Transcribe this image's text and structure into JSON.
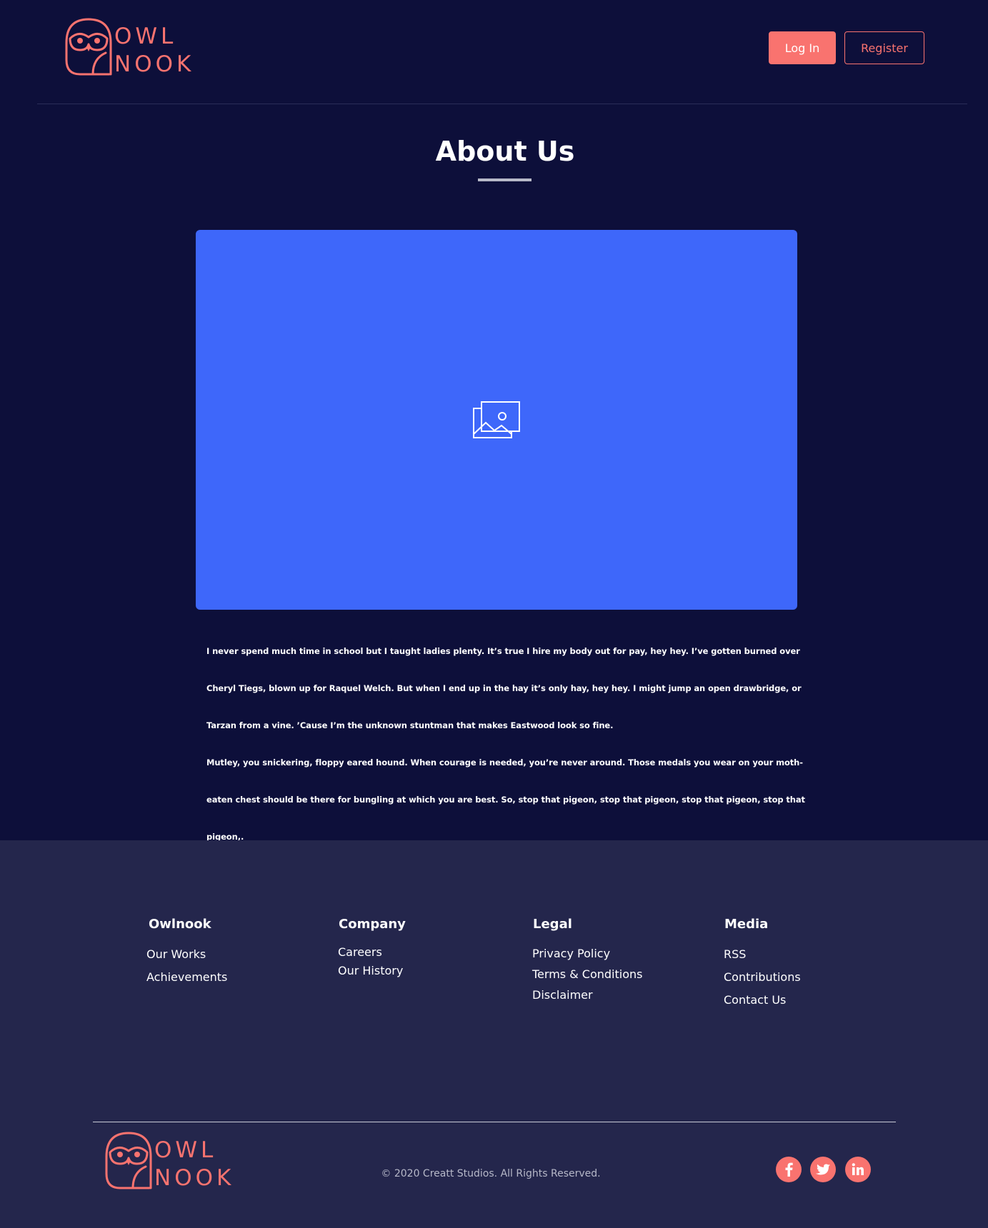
{
  "brand": {
    "logo_line1": "OWL",
    "logo_line2": "NOOK",
    "accent_color": "#f9736f"
  },
  "header": {
    "login_label": "Log In",
    "register_label": "Register"
  },
  "main": {
    "title": "About Us",
    "image_icon": "image-placeholder-icon",
    "image_bg_color": "#3e67fa",
    "paragraphs": [
      "I never spend much time in school but I taught ladies plenty. It’s true I hire my body out for pay, hey hey. I’ve gotten burned over Cheryl Tiegs, blown up for Raquel Welch. But when I end up in the hay it’s only hay, hey hey. I might jump an open drawbridge, or Tarzan from a vine. ’Cause I’m the unknown stuntman that makes Eastwood look so fine.",
      "Mutley, you snickering, floppy eared hound. When courage is needed, you’re never around. Those medals you wear on your moth-eaten chest should be there for bungling at which you are best. So, stop that pigeon, stop that pigeon, stop that pigeon, stop that pigeon,."
    ]
  },
  "footer": {
    "columns": [
      {
        "heading": "Owlnook",
        "links": [
          "Our Works",
          "Achievements"
        ]
      },
      {
        "heading": "Company",
        "links": [
          "Careers",
          "Our History"
        ]
      },
      {
        "heading": "Legal",
        "links": [
          "Privacy Policy",
          "Terms & Conditions",
          "Disclaimer"
        ]
      },
      {
        "heading": "Media",
        "links": [
          "RSS",
          "Contributions",
          "Contact Us"
        ]
      }
    ],
    "copyright": "© 2020 Creatt Studios. All Rights Reserved.",
    "social": [
      "facebook-icon",
      "twitter-icon",
      "linkedin-icon"
    ]
  }
}
